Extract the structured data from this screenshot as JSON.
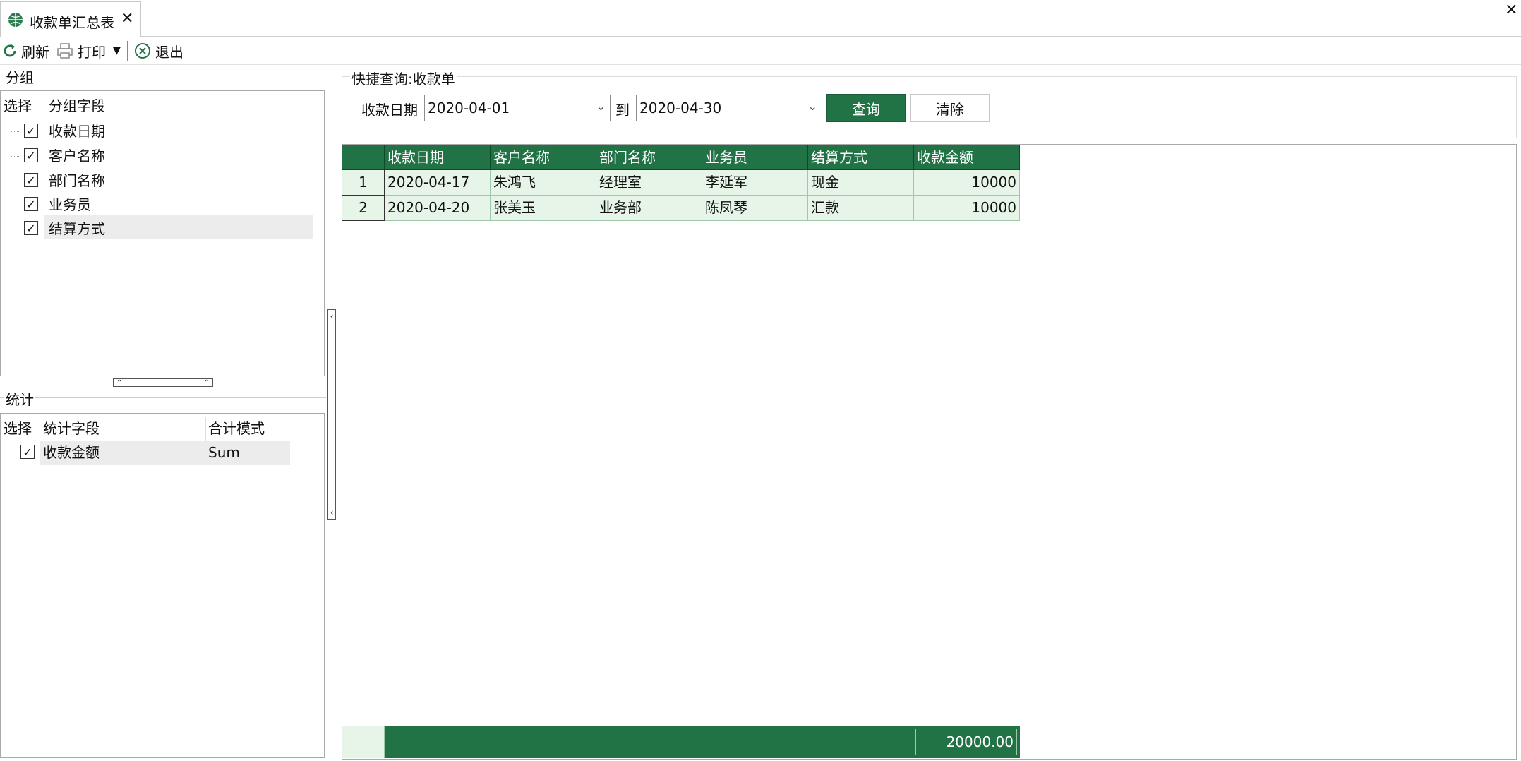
{
  "tab": {
    "title": "收款单汇总表"
  },
  "toolbar": {
    "refresh": "刷新",
    "print": "打印",
    "exit": "退出"
  },
  "group_panel": {
    "title": "分组",
    "headers": {
      "select": "选择",
      "field": "分组字段"
    },
    "items": [
      {
        "label": "收款日期",
        "checked": true
      },
      {
        "label": "客户名称",
        "checked": true
      },
      {
        "label": "部门名称",
        "checked": true
      },
      {
        "label": "业务员",
        "checked": true
      },
      {
        "label": "结算方式",
        "checked": true
      }
    ]
  },
  "stat_panel": {
    "title": "统计",
    "headers": {
      "select": "选择",
      "field": "统计字段",
      "mode": "合计模式"
    },
    "items": [
      {
        "label": "收款金额",
        "mode": "Sum",
        "checked": true
      }
    ]
  },
  "query": {
    "title": "快捷查询:收款单",
    "date_label": "收款日期",
    "from": "2020-04-01",
    "to_label": "到",
    "to": "2020-04-30",
    "search_button": "查询",
    "clear_button": "清除"
  },
  "table": {
    "columns": [
      "收款日期",
      "客户名称",
      "部门名称",
      "业务员",
      "结算方式",
      "收款金额"
    ],
    "rows": [
      {
        "no": "1",
        "cells": [
          "2020-04-17",
          "朱鸿飞",
          "经理室",
          "李延军",
          "现金",
          "10000"
        ]
      },
      {
        "no": "2",
        "cells": [
          "2020-04-20",
          "张美玉",
          "业务部",
          "陈凤琴",
          "汇款",
          "10000"
        ]
      }
    ],
    "total": "20000.00"
  },
  "colors": {
    "accent": "#217346",
    "row_bg": "#e6f5e8"
  }
}
